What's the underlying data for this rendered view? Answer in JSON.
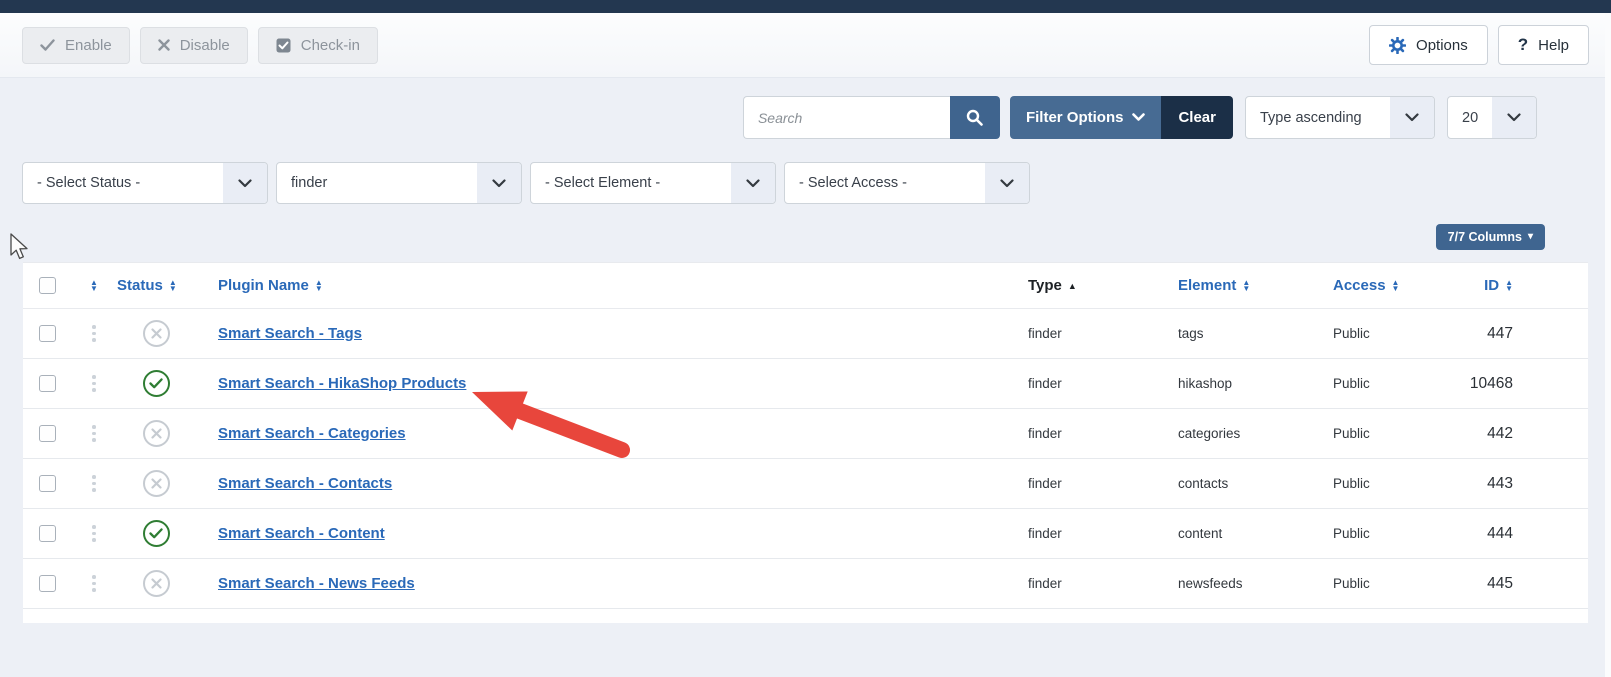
{
  "toolbar": {
    "enable_label": "Enable",
    "disable_label": "Disable",
    "checkin_label": "Check-in",
    "options_label": "Options",
    "help_label": "Help",
    "help_glyph": "?"
  },
  "filters": {
    "search_placeholder": "Search",
    "filter_options_label": "Filter Options",
    "clear_label": "Clear",
    "sort_value": "Type ascending",
    "limit_value": "20",
    "status_select": "- Select Status -",
    "folder_select": "finder",
    "element_select": "- Select Element -",
    "access_select": "- Select Access -"
  },
  "columns_button_label": "7/7 Columns",
  "table": {
    "headers": {
      "status": "Status",
      "plugin_name": "Plugin Name",
      "type": "Type",
      "element": "Element",
      "access": "Access",
      "id": "ID"
    },
    "sort_column": "Type",
    "sort_direction": "ascending",
    "rows": [
      {
        "status": "disabled",
        "name": "Smart Search - Tags",
        "type": "finder",
        "element": "tags",
        "access": "Public",
        "id": "447"
      },
      {
        "status": "enabled",
        "name": "Smart Search - HikaShop Products",
        "type": "finder",
        "element": "hikashop",
        "access": "Public",
        "id": "10468"
      },
      {
        "status": "disabled",
        "name": "Smart Search - Categories",
        "type": "finder",
        "element": "categories",
        "access": "Public",
        "id": "442"
      },
      {
        "status": "disabled",
        "name": "Smart Search - Contacts",
        "type": "finder",
        "element": "contacts",
        "access": "Public",
        "id": "443"
      },
      {
        "status": "enabled",
        "name": "Smart Search - Content",
        "type": "finder",
        "element": "content",
        "access": "Public",
        "id": "444"
      },
      {
        "status": "disabled",
        "name": "Smart Search - News Feeds",
        "type": "finder",
        "element": "newsfeeds",
        "access": "Public",
        "id": "445"
      }
    ],
    "annotation": "red arrow pointing at Smart Search - HikaShop Products"
  },
  "colors": {
    "topbar": "#233750",
    "accent_blue": "#2a69b8",
    "steel_blue": "#3f648e",
    "dark_navy": "#1b2f47",
    "enabled_green": "#2f7d33",
    "disabled_gray": "#c6cbd1",
    "arrow_red": "#e8463c",
    "page_bg": "#edf0f6"
  }
}
